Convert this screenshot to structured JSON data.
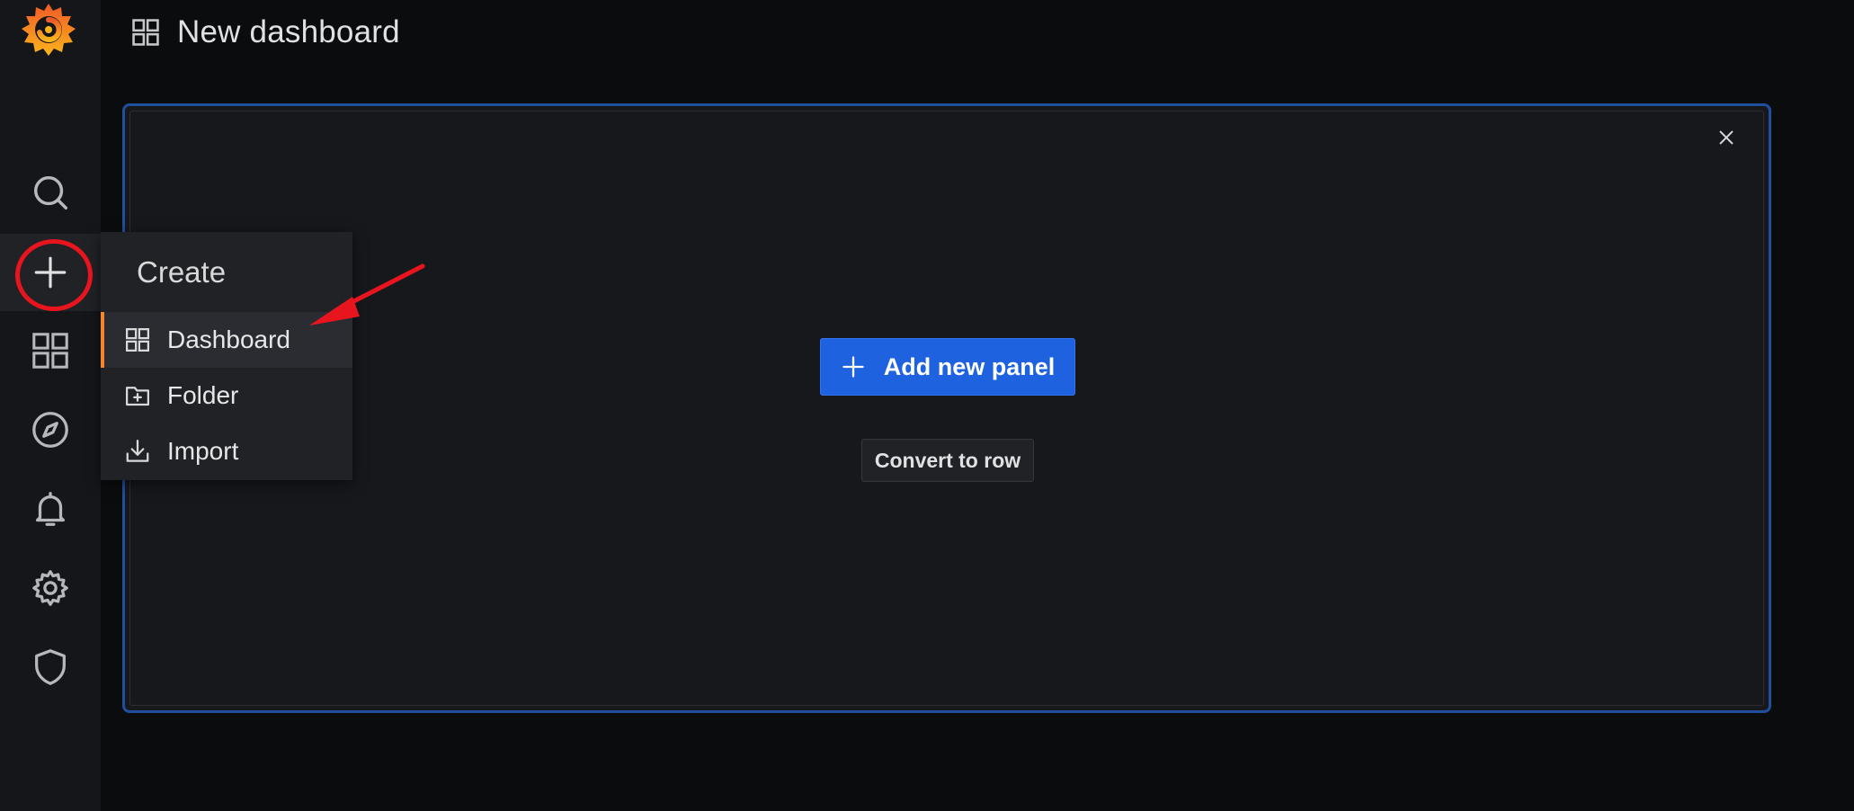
{
  "header": {
    "title": "New dashboard",
    "icon": "apps-grid-icon"
  },
  "sidebar": {
    "logo": "grafana-logo",
    "items": [
      {
        "name": "search",
        "icon": "search-icon"
      },
      {
        "name": "create",
        "icon": "plus-icon",
        "active": true
      },
      {
        "name": "dashboards",
        "icon": "apps-grid-icon"
      },
      {
        "name": "explore",
        "icon": "compass-icon"
      },
      {
        "name": "alerting",
        "icon": "bell-icon"
      },
      {
        "name": "configuration",
        "icon": "gear-icon"
      },
      {
        "name": "server-admin",
        "icon": "shield-icon"
      }
    ]
  },
  "create_menu": {
    "header": "Create",
    "items": [
      {
        "label": "Dashboard",
        "icon": "apps-grid-icon",
        "selected": true
      },
      {
        "label": "Folder",
        "icon": "folder-plus-icon"
      },
      {
        "label": "Import",
        "icon": "import-icon"
      }
    ]
  },
  "panel": {
    "add_button_label": "Add new panel",
    "convert_button_label": "Convert to row",
    "close_icon": "close-icon"
  },
  "colors": {
    "accent_blue": "#1f62e0",
    "panel_border": "#1f4f9d",
    "active_indicator": "#f5872a",
    "annotation_red": "#e8141e",
    "background": "#0b0c0e",
    "sidebar": "#141619"
  }
}
